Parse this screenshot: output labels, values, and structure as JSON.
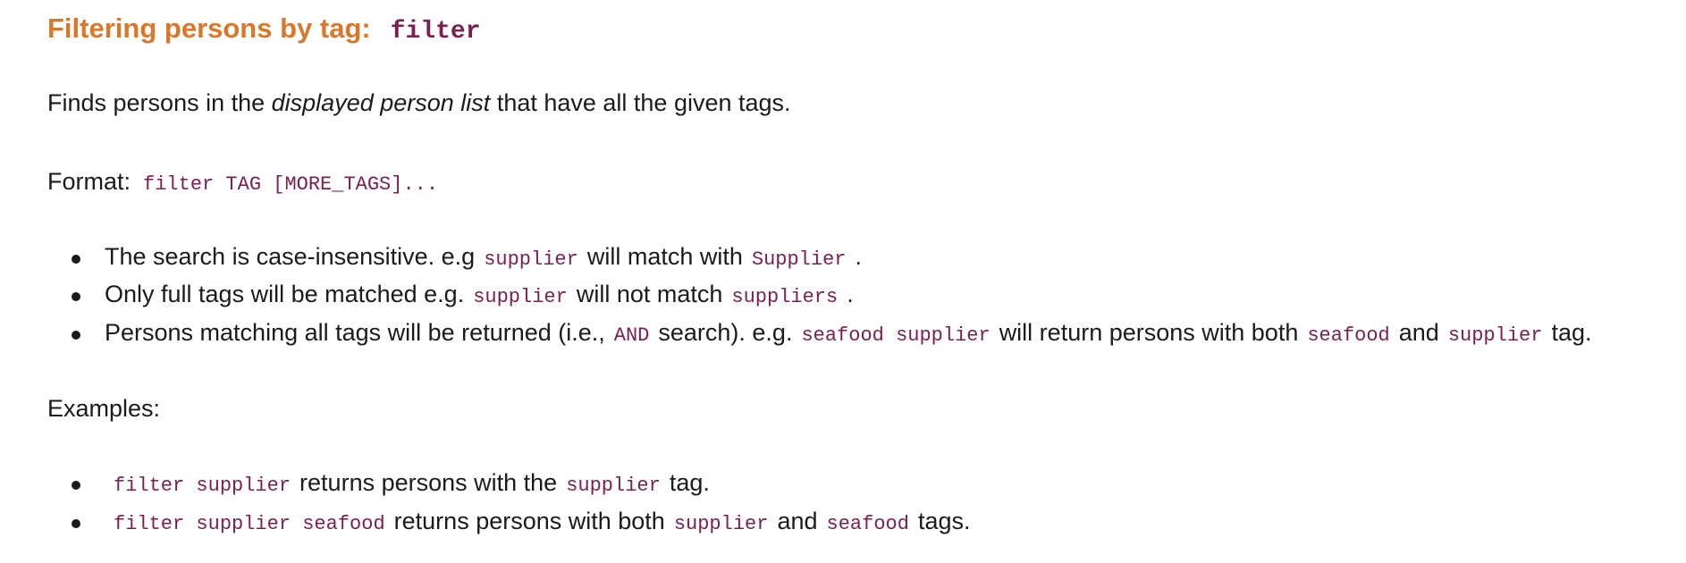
{
  "heading": {
    "text": "Filtering persons by tag:",
    "command": "filter"
  },
  "intro": {
    "before": "Finds persons in the",
    "emphasis": "displayed person list",
    "after": "that have all the given tags."
  },
  "format": {
    "label": "Format:",
    "code": "filter TAG [MORE_TAGS]..."
  },
  "notes": [
    {
      "t1": "The search is case-insensitive. e.g",
      "c1": "supplier",
      "t2": "will match with",
      "c2": "Supplier",
      "t3": "."
    },
    {
      "t1": "Only full tags will be matched e.g.",
      "c1": "supplier",
      "t2": "will not match",
      "c2": "suppliers",
      "t3": "."
    },
    {
      "t1": "Persons matching all tags will be returned (i.e.,",
      "c1": "AND",
      "t2": "search). e.g.",
      "c2": "seafood supplier",
      "t3": "will return persons with both",
      "c3": "seafood",
      "t4": "and",
      "c4": "supplier",
      "t5": "tag."
    }
  ],
  "examples": {
    "label": "Examples:",
    "items": [
      {
        "c1": "filter supplier",
        "t1": "returns persons with the",
        "c2": "supplier",
        "t2": "tag."
      },
      {
        "c1": "filter supplier seafood",
        "t1": "returns persons with both",
        "c2": "supplier",
        "t2": "and",
        "c3": "seafood",
        "t3": "tags."
      }
    ]
  }
}
